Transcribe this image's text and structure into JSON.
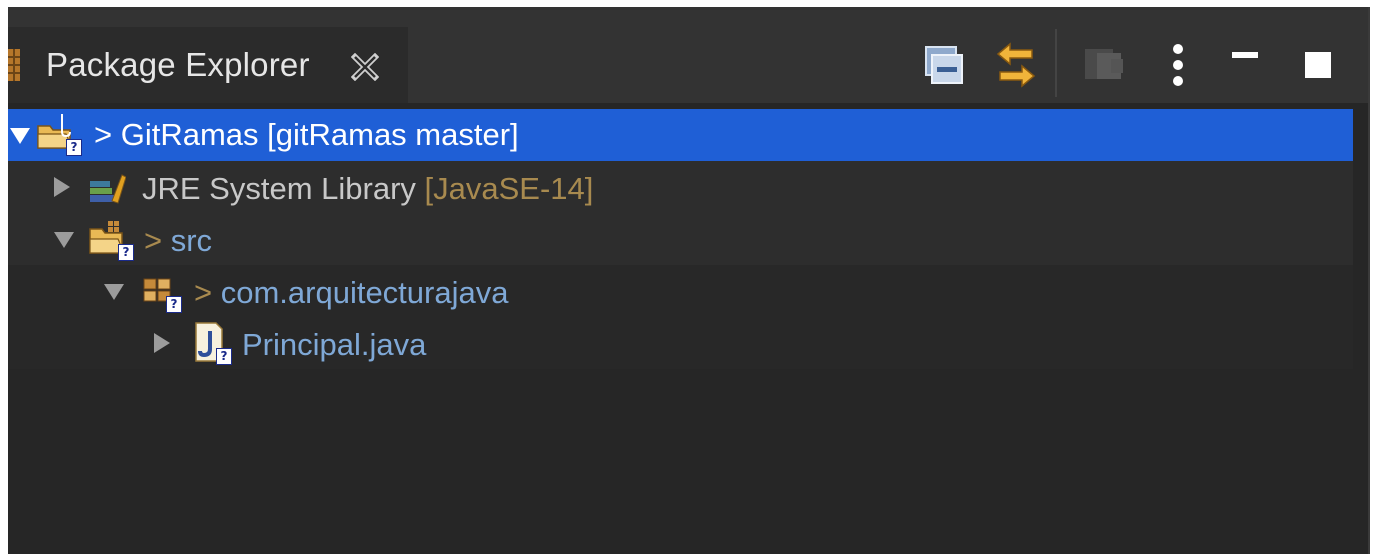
{
  "view": {
    "title": "Package Explorer"
  },
  "toolbar": {
    "collapse_all": "collapse-all-icon",
    "link_with_editor": "link-with-editor-icon",
    "focus": "focus-on-active-task-icon",
    "view_menu": "view-menu-icon",
    "minimize": "minimize-icon",
    "maximize": "maximize-icon"
  },
  "tree": {
    "project": {
      "prefix": "> ",
      "name": "GitRamas [gitRamas master]"
    },
    "jre": {
      "name": "JRE System Library ",
      "decoration": "[JavaSE-14]"
    },
    "src": {
      "prefix": "> ",
      "name": "src"
    },
    "package": {
      "prefix": "> ",
      "name": "com.arquitecturajava"
    },
    "file": {
      "name": "Principal.java"
    }
  },
  "colors": {
    "selection": "#1f5fd6",
    "background": "#262626",
    "header": "#333333",
    "decoration": "#a88a4f",
    "resource_text": "#7fa8d6"
  }
}
